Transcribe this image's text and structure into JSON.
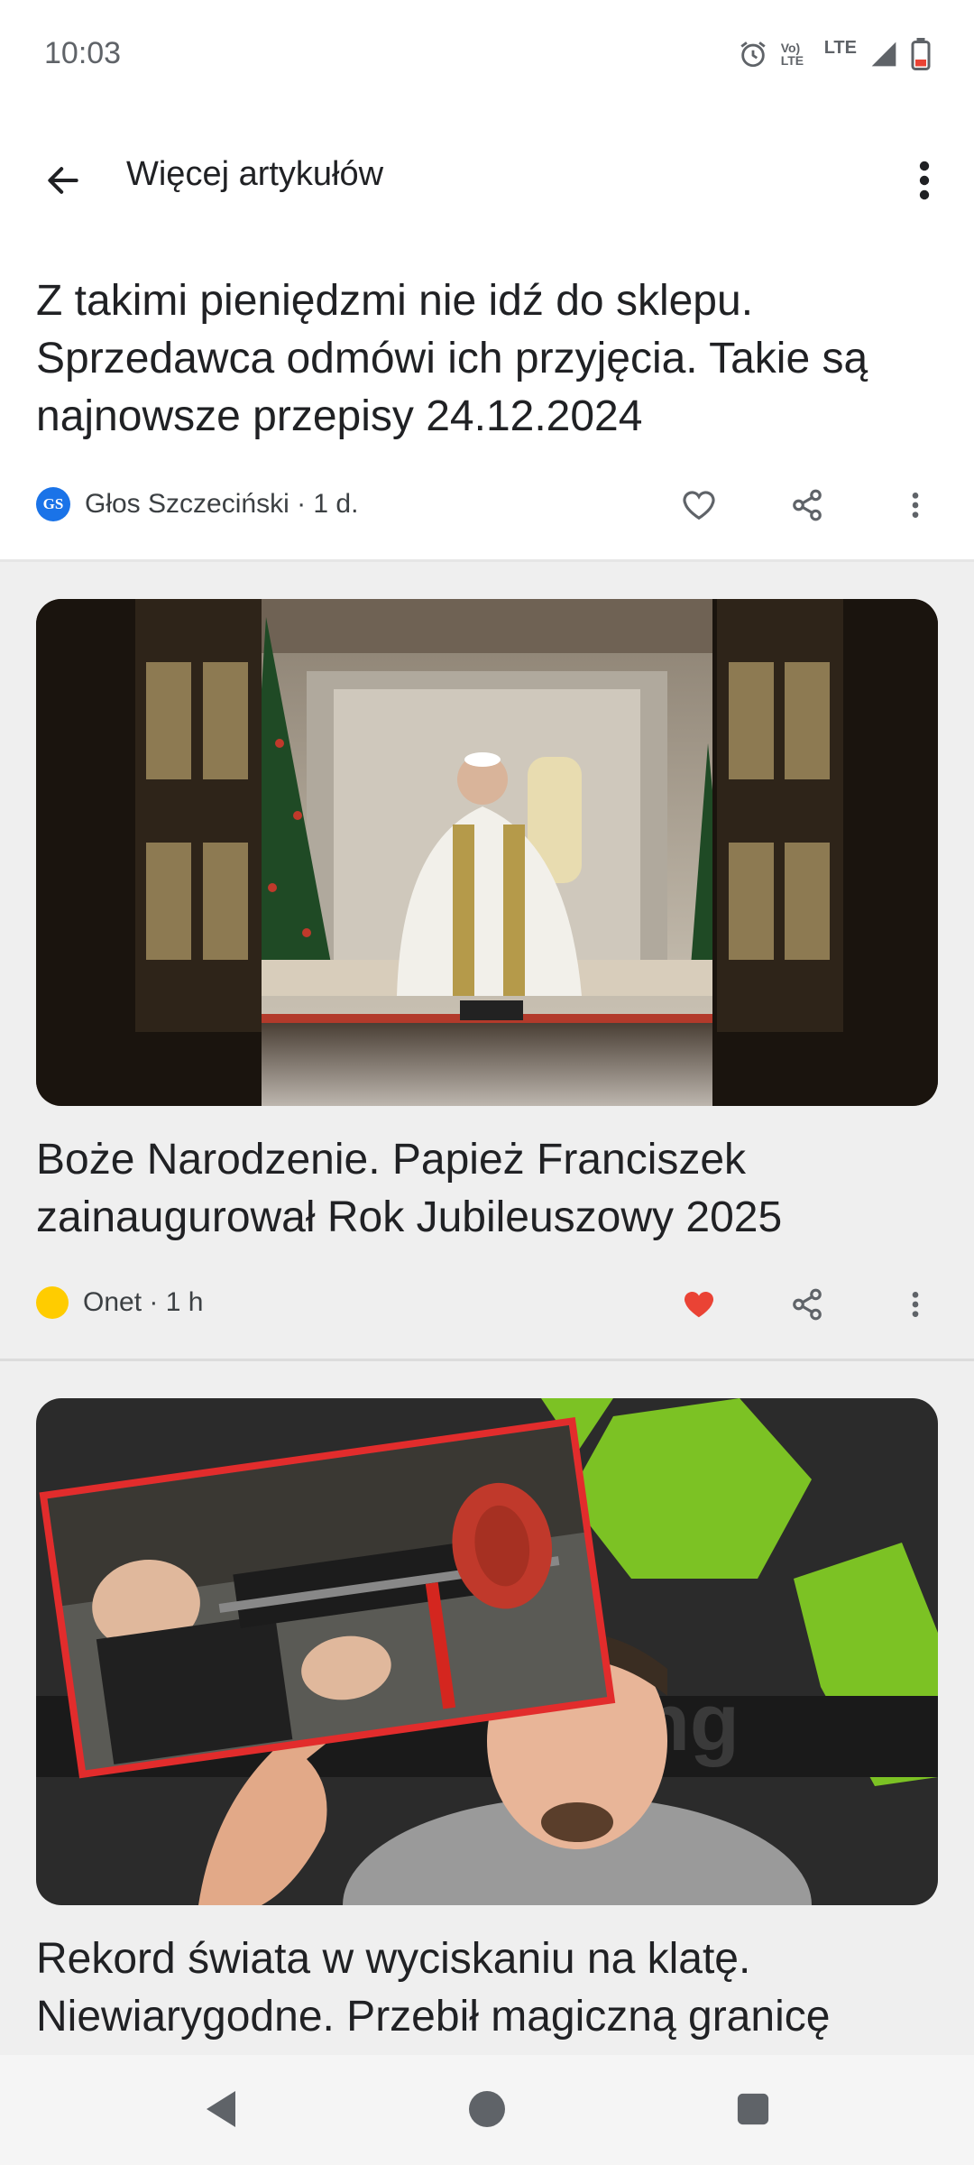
{
  "status_bar": {
    "time": "10:03",
    "volte_label": "Vo) LTE",
    "lte_label": "LTE",
    "icons": [
      "alarm-icon",
      "volte-icon",
      "lte-signal-icon",
      "battery-icon"
    ]
  },
  "app_bar": {
    "back_icon": "arrow-left-icon",
    "title": "Więcej artykułów",
    "menu_icon": "more-vert-icon"
  },
  "articles": [
    {
      "headline": "Z takimi pieniędzmi nie idź do sklepu. Sprzedawca odmówi ich przyjęcia. Takie są najnowsze przepisy 24.12.2024",
      "source_logo_text": "GS",
      "source": "Głos Szczeciński · 1 d.",
      "liked": false
    },
    {
      "headline": "Boże Narodzenie. Papież Franciszek zainaugurował Rok Jubileuszowy 2025",
      "source": "Onet · 1 h",
      "liked": true,
      "image": "photo of pope seated between open bronze doors"
    },
    {
      "headline": "Rekord świata w wyciskaniu na klatę. Niewiarygodne. Przebił magiczną granicę",
      "image": "photo of powerlifter pointing at inset bench press image"
    }
  ],
  "colors": {
    "heart_liked": "#ea4335",
    "onet_dot": "#ffcc00",
    "gs_logo": "#1a73e8",
    "feed_background": "#efefef"
  },
  "nav_bar": {
    "icons": [
      "back-triangle-icon",
      "home-circle-icon",
      "recents-square-icon"
    ]
  }
}
